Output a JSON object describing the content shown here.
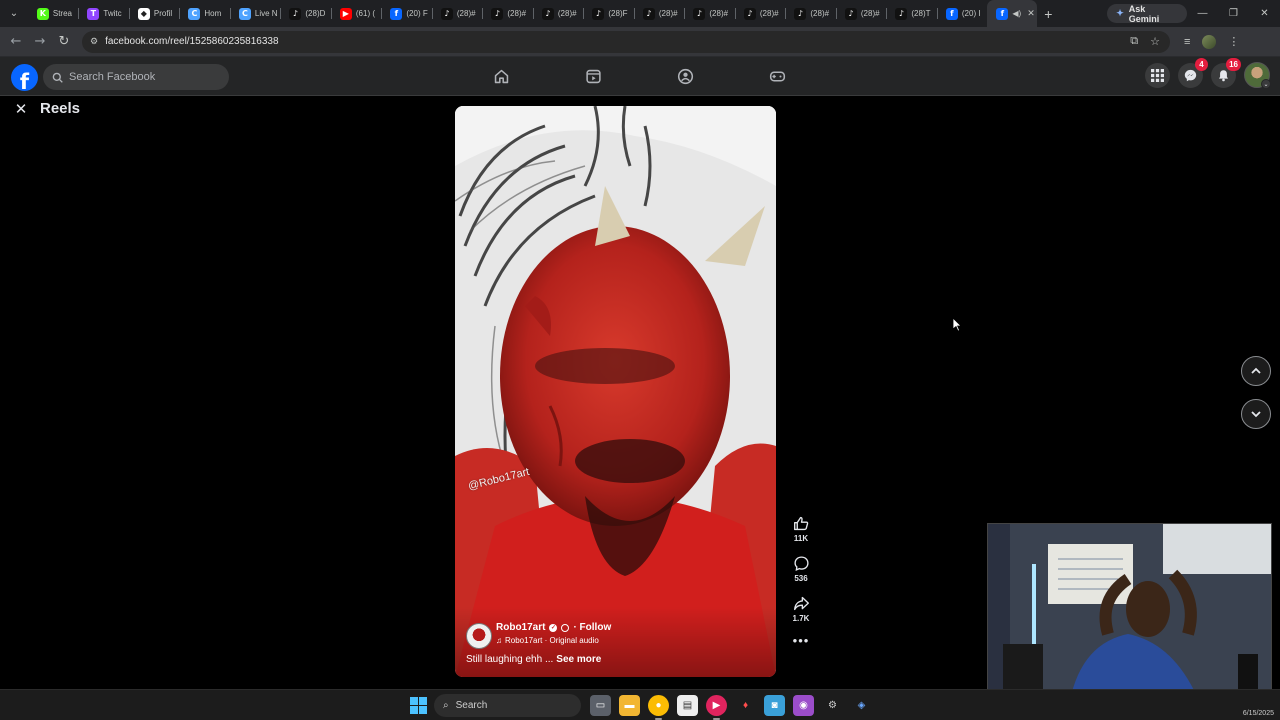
{
  "browser": {
    "tabs": [
      {
        "title": "Strea",
        "favicon": "kick-icon",
        "color": "#53fc18",
        "glyph": "K"
      },
      {
        "title": "Twitc",
        "favicon": "twitch-icon",
        "color": "#9146ff",
        "glyph": "T"
      },
      {
        "title": "Profil",
        "favicon": "profile-icon",
        "color": "#ffffff",
        "glyph": "◆"
      },
      {
        "title": "Hom",
        "favicon": "home-site-icon",
        "color": "#4fa3ff",
        "glyph": "C"
      },
      {
        "title": "Live N",
        "favicon": "live-icon",
        "color": "#4fa3ff",
        "glyph": "C"
      },
      {
        "title": "(28)D",
        "favicon": "tiktok-icon",
        "color": "#111111",
        "glyph": "♪"
      },
      {
        "title": "(61) (",
        "favicon": "youtube-icon",
        "color": "#ff0000",
        "glyph": "▶"
      },
      {
        "title": "(20) F",
        "favicon": "facebook-icon",
        "color": "#0866ff",
        "glyph": "f"
      },
      {
        "title": "(28)#",
        "favicon": "tiktok-icon",
        "color": "#111111",
        "glyph": "♪"
      },
      {
        "title": "(28)#",
        "favicon": "tiktok-icon",
        "color": "#111111",
        "glyph": "♪"
      },
      {
        "title": "(28)#",
        "favicon": "tiktok-icon",
        "color": "#111111",
        "glyph": "♪"
      },
      {
        "title": "(28)F",
        "favicon": "tiktok-icon",
        "color": "#111111",
        "glyph": "♪"
      },
      {
        "title": "(28)#",
        "favicon": "tiktok-icon",
        "color": "#111111",
        "glyph": "♪"
      },
      {
        "title": "(28)#",
        "favicon": "tiktok-icon",
        "color": "#111111",
        "glyph": "♪"
      },
      {
        "title": "(28)#",
        "favicon": "tiktok-icon",
        "color": "#111111",
        "glyph": "♪"
      },
      {
        "title": "(28)#",
        "favicon": "tiktok-icon",
        "color": "#111111",
        "glyph": "♪"
      },
      {
        "title": "(28)#",
        "favicon": "tiktok-icon",
        "color": "#111111",
        "glyph": "♪"
      },
      {
        "title": "(28)T",
        "favicon": "tiktok-icon",
        "color": "#111111",
        "glyph": "♪"
      },
      {
        "title": "(20) I",
        "favicon": "facebook-icon",
        "color": "#0866ff",
        "glyph": "f"
      }
    ],
    "active_tab": {
      "favicon": "facebook-icon",
      "color": "#0866ff",
      "glyph": "f",
      "audio_icon": "speaker-icon"
    },
    "gemini_label": "Ask Gemini",
    "url": "facebook.com/reel/1525860235816338"
  },
  "facebook": {
    "search_placeholder": "Search Facebook",
    "messenger_badge": "4",
    "notifications_badge": "16",
    "brand_color": "#0866ff",
    "badge_color": "#e41e3f"
  },
  "reels": {
    "title": "Reels",
    "watermark": "@Robo17art",
    "author": "Robo17art",
    "follow_label": "· Follow",
    "audio": "Robo17art · Original audio",
    "caption": "Still laughing ehh ...",
    "see_more": "See more",
    "likes": "11K",
    "comments": "536",
    "shares": "1.7K"
  },
  "taskbar": {
    "search_placeholder": "Search",
    "date": "6/15/2025"
  }
}
